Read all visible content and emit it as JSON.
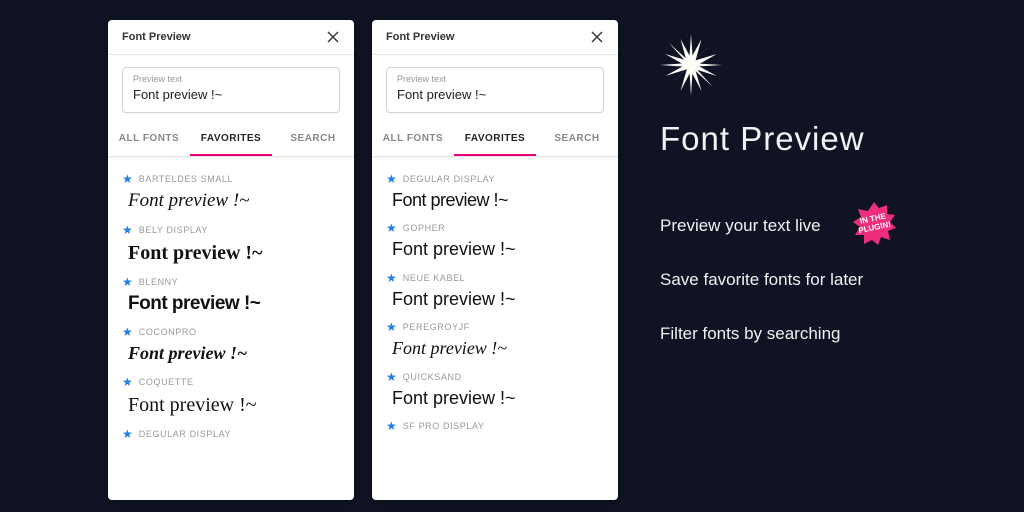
{
  "window_title": "Font Preview",
  "preview_label": "Preview text",
  "preview_value": "Font preview !~",
  "tabs": {
    "all": "ALL FONTS",
    "fav": "FAVORITES",
    "search": "SEARCH"
  },
  "panel_left": [
    {
      "name": "BARTELDES SMALL",
      "cls": "sample-barteldes"
    },
    {
      "name": "BELY DISPLAY",
      "cls": "sample-bely"
    },
    {
      "name": "BLENNY",
      "cls": "sample-blenny"
    },
    {
      "name": "COCONPRO",
      "cls": "sample-cocon"
    },
    {
      "name": "COQUETTE",
      "cls": "sample-coquette"
    },
    {
      "name": "DEGULAR DISPLAY",
      "cls": "sample-degular",
      "nameOnly": true
    }
  ],
  "panel_right": [
    {
      "name": "DEGULAR DISPLAY",
      "cls": "sample-degular"
    },
    {
      "name": "GOPHER",
      "cls": "sample-gopher"
    },
    {
      "name": "NEUE KABEL",
      "cls": "sample-neuekabel"
    },
    {
      "name": "PEREGROYJF",
      "cls": "sample-peregroy"
    },
    {
      "name": "QUICKSAND",
      "cls": "sample-quicksand"
    },
    {
      "name": "SF PRO DISPLAY",
      "cls": "",
      "nameOnly": true
    }
  ],
  "promo": {
    "title": "Font Preview",
    "line1_bold": "Preview",
    "line1_rest": " your text live",
    "badge": "IN THE PLUGIN!",
    "line2_bold": "Save",
    "line2_rest": " favorite fonts for later",
    "line3_bold": "Filter",
    "line3_rest": " fonts by searching"
  }
}
